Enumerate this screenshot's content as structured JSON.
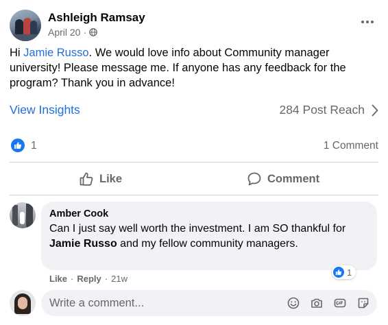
{
  "post": {
    "author": "Ashleigh Ramsay",
    "date": "April 20",
    "date_separator": "·",
    "text_before": "Hi ",
    "mention": "Jamie Russo",
    "text_after": ". We would love info about Community manager university! Please message me.  If anyone has any feedback for the program? Thank you in advance!",
    "view_insights": "View Insights",
    "reach": "284 Post Reach",
    "reaction_count": "1",
    "comment_count": "1 Comment"
  },
  "actions": {
    "like": "Like",
    "comment": "Comment"
  },
  "comment": {
    "author": "Amber Cook",
    "text_before": "Can I just say well worth the investment. I am SO thankful for ",
    "mention": "Jamie Russo",
    "text_after": " and my fellow community managers.",
    "reaction_count": "1",
    "like_link": "Like",
    "reply_link": "Reply",
    "separator": "·",
    "age": "21w"
  },
  "composer": {
    "placeholder": "Write a comment..."
  },
  "colors": {
    "link_blue": "#216fdb",
    "facebook_blue": "#1877f2",
    "secondary_text": "#65676b",
    "bubble_bg": "#f0f2f5"
  },
  "icons": [
    "globe-icon",
    "more-icon",
    "chevron-right-icon",
    "like-icon",
    "thumbs-up-icon",
    "comment-icon",
    "emoji-icon",
    "camera-icon",
    "gif-icon",
    "sticker-icon"
  ]
}
